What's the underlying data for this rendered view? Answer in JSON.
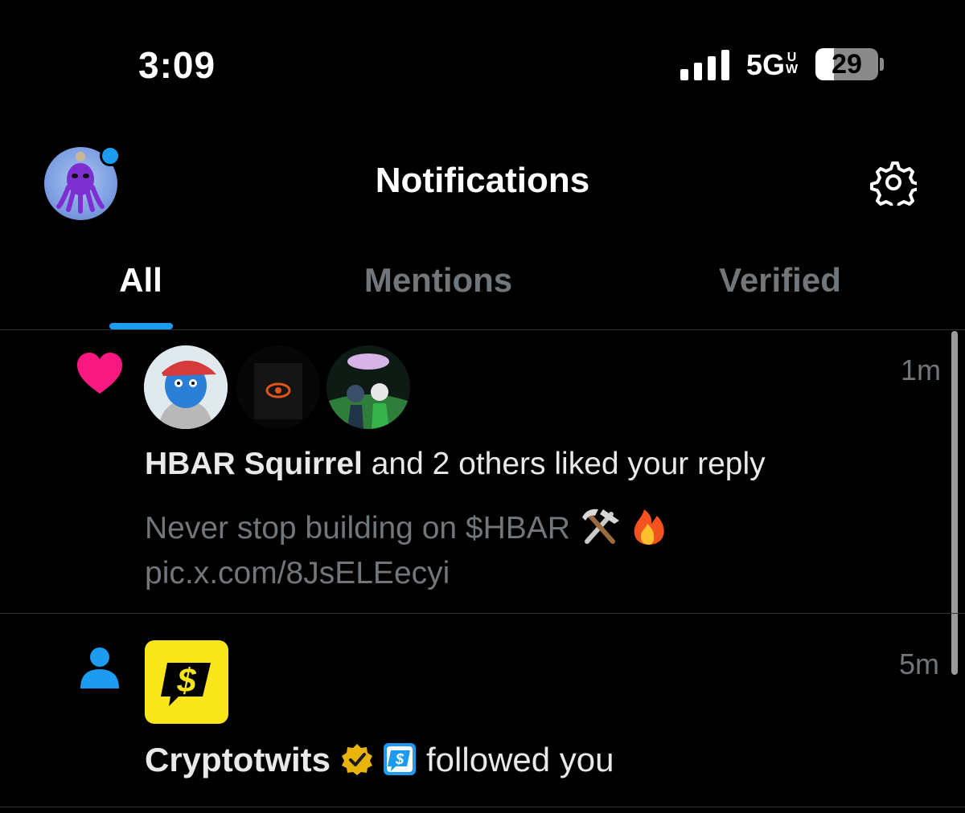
{
  "status_bar": {
    "time": "3:09",
    "network": "5G",
    "network_sub_top": "U",
    "network_sub_bottom": "W",
    "battery": "29",
    "battery_level": 0.29
  },
  "header": {
    "title": "Notifications"
  },
  "tabs": [
    {
      "label": "All",
      "active": true
    },
    {
      "label": "Mentions",
      "active": false
    },
    {
      "label": "Verified",
      "active": false
    }
  ],
  "notifications": [
    {
      "type": "like",
      "icon": "heart-icon",
      "time": "1m",
      "actor": "HBAR Squirrel",
      "action": " and 2 others liked your reply",
      "preview_text": "Never stop building on $HBAR ",
      "preview_link": "pic.x.com/8JsELEecyi"
    },
    {
      "type": "follow",
      "icon": "person-icon",
      "time": "5m",
      "actor": "Cryptotwits",
      "action": "followed you"
    }
  ],
  "colors": {
    "accent": "#1d9bf0",
    "like": "#f91880",
    "muted": "#71767b",
    "verified_gold": "#e8b40c",
    "cryptotwits_yellow": "#f8e51a"
  }
}
